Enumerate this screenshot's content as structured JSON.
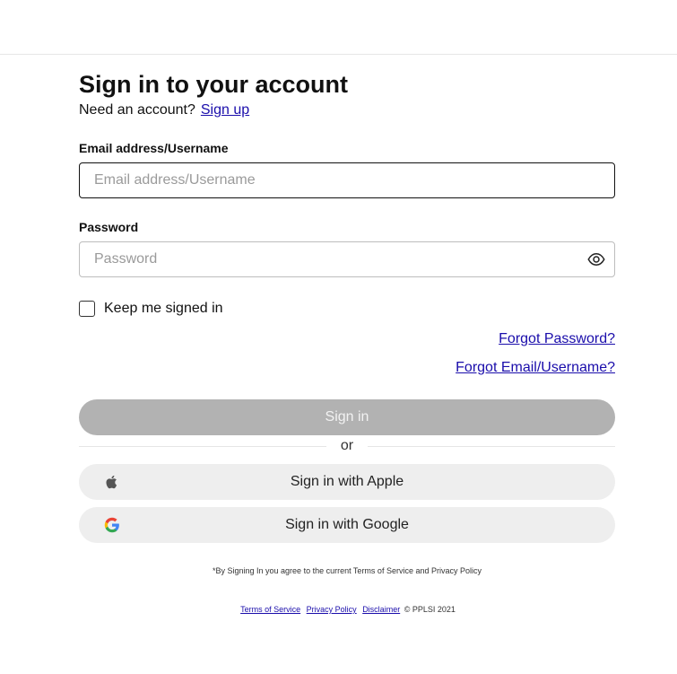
{
  "header": {
    "title": "Sign in to your account",
    "need_account": "Need an account?",
    "signup_link": "Sign up"
  },
  "email": {
    "label": "Email address/Username",
    "placeholder": "Email address/Username",
    "value": ""
  },
  "password": {
    "label": "Password",
    "placeholder": "Password",
    "value": "",
    "toggle_icon": "eye-icon"
  },
  "keep_signed_in": {
    "label": "Keep me signed in",
    "checked": false
  },
  "links": {
    "forgot_password": "Forgot Password?",
    "forgot_email": "Forgot Email/Username?"
  },
  "buttons": {
    "sign_in": "Sign in",
    "or": "or",
    "apple": "Sign in with Apple",
    "google": "Sign in with Google"
  },
  "agreement": "*By Signing In you agree to the current Terms of Service and Privacy Policy",
  "footer": {
    "terms": "Terms of Service",
    "privacy": "Privacy Policy",
    "disclaimer": "Disclaimer",
    "copyright": "© PPLSI 2021"
  },
  "colors": {
    "link": "#1a0dab",
    "disabled_button": "#b2b2b2",
    "social_button": "#eeeeee"
  }
}
